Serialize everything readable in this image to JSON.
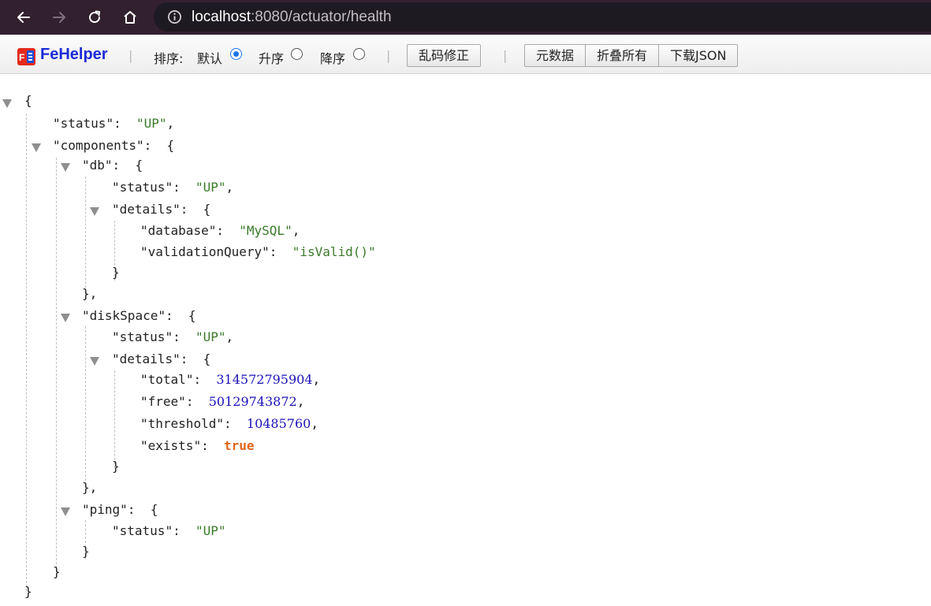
{
  "browser": {
    "url_host": "localhost",
    "url_rest": ":8080/actuator/health",
    "colors": {
      "frame": "#33202e",
      "omnibox": "#1e1a21"
    },
    "icons": [
      "back-arrow-icon",
      "forward-arrow-icon",
      "reload-icon",
      "home-icon",
      "info-icon"
    ]
  },
  "toolbar": {
    "brand": "FeHelper",
    "brand_color": "#1c2bd6",
    "sort_label": "排序:",
    "sort_options": [
      {
        "label": "默认",
        "checked": true
      },
      {
        "label": "升序",
        "checked": false
      },
      {
        "label": "降序",
        "checked": false
      }
    ],
    "fix_encoding": "乱码修正",
    "buttons": [
      "元数据",
      "折叠所有",
      "下载JSON"
    ],
    "separator": "|"
  },
  "json": {
    "status": "UP",
    "db_status": "UP",
    "db_database": "MySQL",
    "db_validationQuery": "isValid()",
    "disk_status": "UP",
    "disk_total": "314572795904",
    "disk_free": "50129743872",
    "disk_threshold": "10485760",
    "disk_exists": "true",
    "ping_status": "UP",
    "keys": {
      "status": "status",
      "components": "components",
      "db": "db",
      "details": "details",
      "database": "database",
      "validationQuery": "validationQuery",
      "diskSpace": "diskSpace",
      "total": "total",
      "free": "free",
      "threshold": "threshold",
      "exists": "exists",
      "ping": "ping"
    }
  }
}
